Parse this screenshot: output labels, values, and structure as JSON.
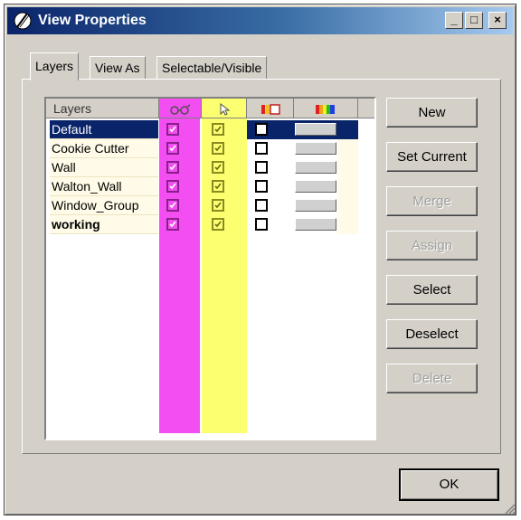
{
  "window": {
    "title": "View Properties",
    "controls": {
      "minimize": "_",
      "maximize": "□",
      "close": "×"
    }
  },
  "tabs": [
    {
      "label": "Layers",
      "active": true
    },
    {
      "label": "View As",
      "active": false
    },
    {
      "label": "Selectable/Visible",
      "active": false
    }
  ],
  "table": {
    "header": {
      "name": "Layers",
      "col_visible_icon": "glasses-icon",
      "col_selectable_icon": "cursor-icon",
      "col_color_icon": "rgb-icon",
      "col_swatch_icon": "rainbow-icon"
    },
    "rows": [
      {
        "name": "Default",
        "visible": true,
        "selectable": true,
        "color": false,
        "selected": true,
        "bold": false
      },
      {
        "name": "Cookie Cutter",
        "visible": true,
        "selectable": true,
        "color": false,
        "selected": false,
        "bold": false
      },
      {
        "name": "Wall",
        "visible": true,
        "selectable": true,
        "color": false,
        "selected": false,
        "bold": false
      },
      {
        "name": "Walton_Wall",
        "visible": true,
        "selectable": true,
        "color": false,
        "selected": false,
        "bold": false
      },
      {
        "name": "Window_Group",
        "visible": true,
        "selectable": true,
        "color": false,
        "selected": false,
        "bold": false
      },
      {
        "name": "working",
        "visible": true,
        "selectable": true,
        "color": false,
        "selected": false,
        "bold": true
      }
    ]
  },
  "buttons": [
    {
      "label": "New",
      "enabled": true
    },
    {
      "label": "Set Current",
      "enabled": true
    },
    {
      "label": "Merge",
      "enabled": false
    },
    {
      "label": "Assign",
      "enabled": false
    },
    {
      "label": "Select",
      "enabled": true
    },
    {
      "label": "Deselect",
      "enabled": true
    },
    {
      "label": "Delete",
      "enabled": false
    }
  ],
  "ok_label": "OK",
  "colors": {
    "visible_band": "#f24ef2",
    "selectable_band": "#fbff70",
    "selection": "#0a246a",
    "dialog": "#d4d0c8"
  }
}
